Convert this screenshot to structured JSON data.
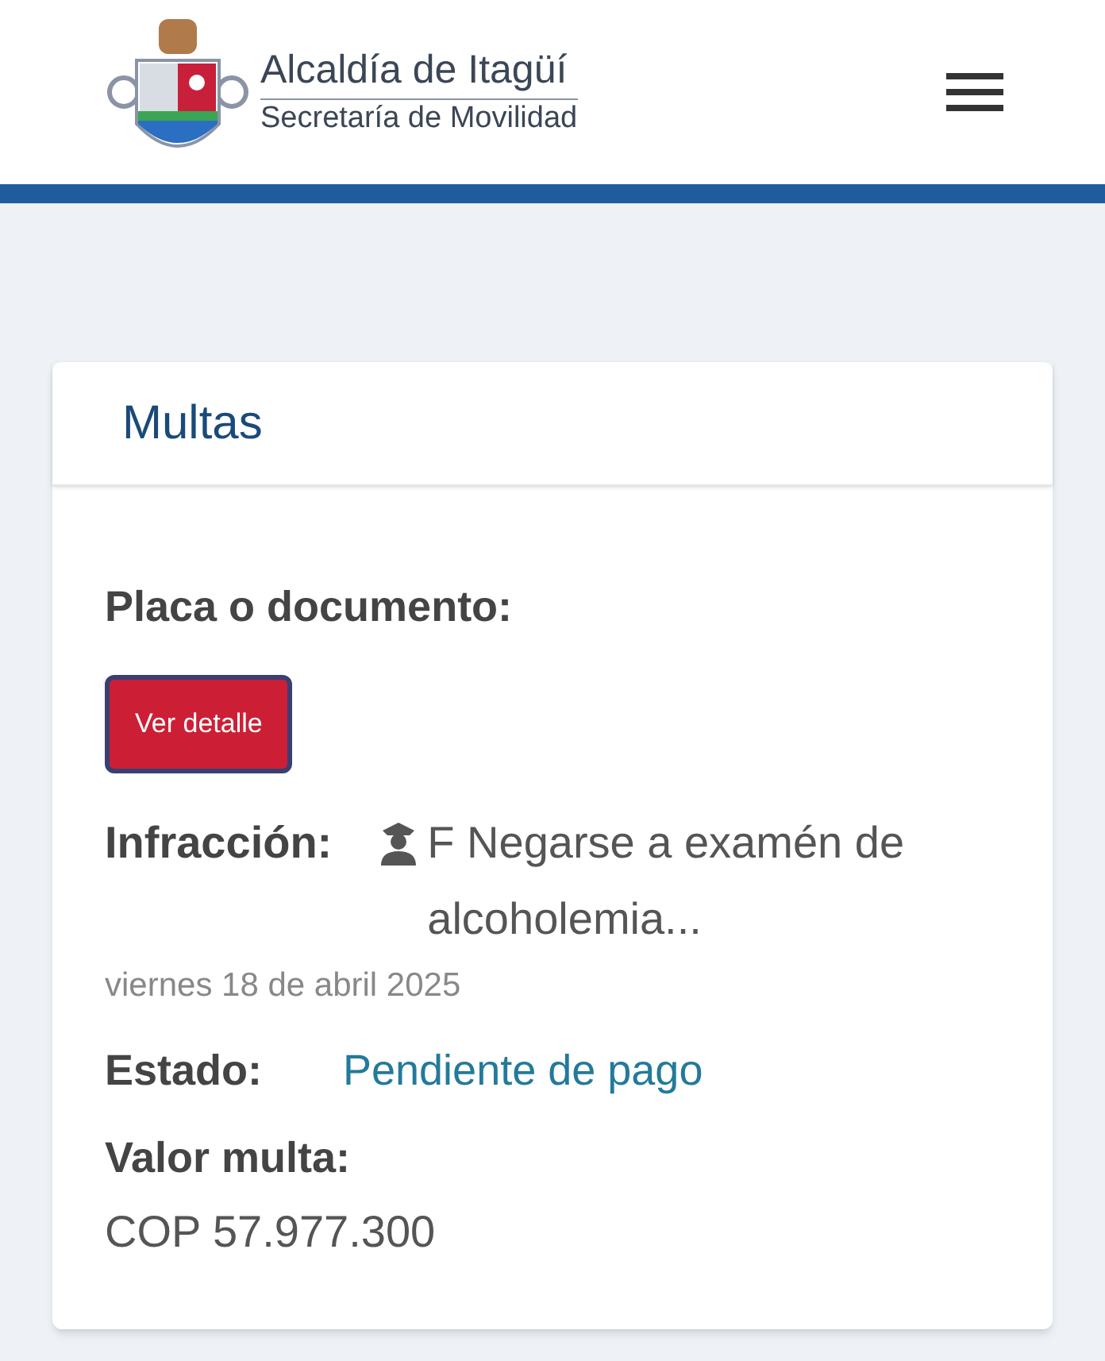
{
  "header": {
    "title": "Alcaldía de Itagüí",
    "subtitle": "Secretaría de Movilidad"
  },
  "card": {
    "title": "Multas",
    "plate_label": "Placa o documento:",
    "button": "Ver detalle",
    "infraction_label": "Infracción:",
    "infraction": "F Negarse a examén de alcoholemia...",
    "date": "viernes 18 de abril 2025",
    "status_label": "Estado:",
    "status": "Pendiente de pago",
    "amount_label": "Valor multa:",
    "amount": "COP 57.977.300"
  }
}
